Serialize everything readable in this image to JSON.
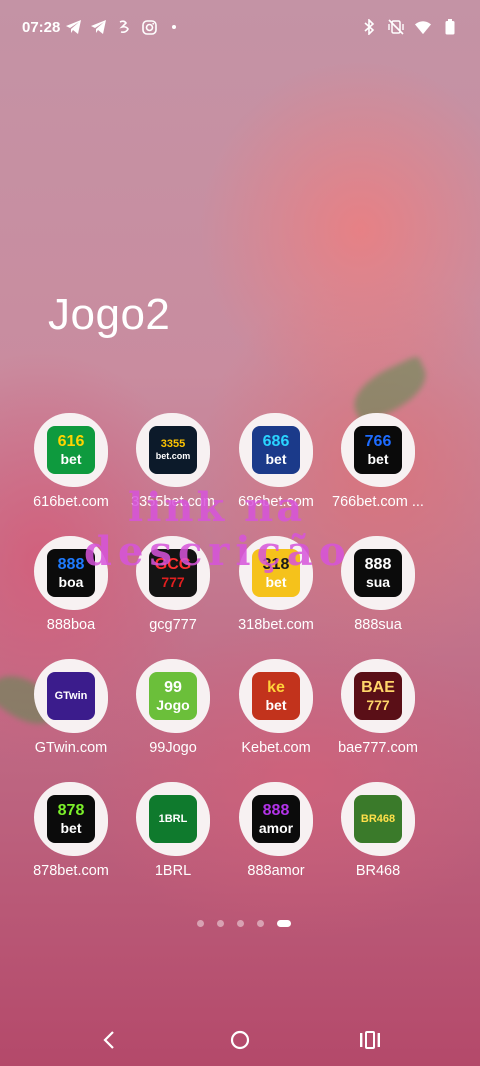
{
  "status_bar": {
    "time": "07:28",
    "left_icons": [
      "telegram-icon",
      "telegram-icon",
      "app-notification-icon",
      "instagram-icon",
      "more-dot-icon"
    ],
    "right_icons": [
      "bluetooth-icon",
      "vibrate-off-icon",
      "wifi-icon",
      "battery-icon"
    ]
  },
  "folder": {
    "title": "Jogo2"
  },
  "apps": [
    {
      "label": "616bet.com",
      "logo_line1": "616",
      "logo_line2": "bet",
      "logo_bg": "#0e9a3e",
      "logo_fg1": "#ffd400",
      "logo_fg2": "#ffffff"
    },
    {
      "label": "3355bet.com",
      "logo_line1": "3355",
      "logo_line2": "bet.com",
      "logo_bg": "#0c1a2a",
      "logo_fg1": "#ffc400",
      "logo_fg2": "#ffffff"
    },
    {
      "label": "686bet.com",
      "logo_line1": "686",
      "logo_line2": "bet",
      "logo_bg": "#1b3a8a",
      "logo_fg1": "#2ad4ff",
      "logo_fg2": "#ffffff"
    },
    {
      "label": "766bet.com ...",
      "logo_line1": "766",
      "logo_line2": "bet",
      "logo_bg": "#0a0a0a",
      "logo_fg1": "#1e6cff",
      "logo_fg2": "#ffffff"
    },
    {
      "label": "888boa",
      "logo_line1": "888",
      "logo_line2": "boa",
      "logo_bg": "#0b0b0b",
      "logo_fg1": "#1e7bff",
      "logo_fg2": "#ffffff"
    },
    {
      "label": "gcg777",
      "logo_line1": "GCG",
      "logo_line2": "777",
      "logo_bg": "#141414",
      "logo_fg1": "#ff3030",
      "logo_fg2": "#e01f1f"
    },
    {
      "label": "318bet.com",
      "logo_line1": "318",
      "logo_line2": "bet",
      "logo_bg": "#f5c21b",
      "logo_fg1": "#1a1a1a",
      "logo_fg2": "#ffffff"
    },
    {
      "label": "888sua",
      "logo_line1": "888",
      "logo_line2": "sua",
      "logo_bg": "#0b0b0b",
      "logo_fg1": "#ffffff",
      "logo_fg2": "#ffffff"
    },
    {
      "label": "GTwin.com",
      "logo_line1": "GTwin",
      "logo_line2": "",
      "logo_bg": "#3b1c8c",
      "logo_fg1": "#ffffff",
      "logo_fg2": "#ffffff"
    },
    {
      "label": "99Jogo",
      "logo_line1": "99",
      "logo_line2": "Jogo",
      "logo_bg": "#6bbf3a",
      "logo_fg1": "#ffffff",
      "logo_fg2": "#ffffff"
    },
    {
      "label": "Kebet.com",
      "logo_line1": "ke",
      "logo_line2": "bet",
      "logo_bg": "#c2331c",
      "logo_fg1": "#ffd23a",
      "logo_fg2": "#ffffff"
    },
    {
      "label": "bae777.com",
      "logo_line1": "BAE",
      "logo_line2": "777",
      "logo_bg": "#5a0f17",
      "logo_fg1": "#ffd56a",
      "logo_fg2": "#ffd56a"
    },
    {
      "label": "878bet.com",
      "logo_line1": "878",
      "logo_line2": "bet",
      "logo_bg": "#0b0b0b",
      "logo_fg1": "#7cf02a",
      "logo_fg2": "#ffffff"
    },
    {
      "label": "1BRL",
      "logo_line1": "1BRL",
      "logo_line2": "",
      "logo_bg": "#0f7a2d",
      "logo_fg1": "#ffffff",
      "logo_fg2": "#ffffff"
    },
    {
      "label": "888amor",
      "logo_line1": "888",
      "logo_line2": "amor",
      "logo_bg": "#0b0b0b",
      "logo_fg1": "#b233e8",
      "logo_fg2": "#ffffff"
    },
    {
      "label": "BR468",
      "logo_line1": "BR468",
      "logo_line2": "",
      "logo_bg": "#3a7a2a",
      "logo_fg1": "#ffe04a",
      "logo_fg2": "#ffffff"
    }
  ],
  "page_indicator": {
    "count": 5,
    "current_page": 5
  },
  "watermark": {
    "line1": "link na",
    "line2": "descrição"
  },
  "nav_bar": {
    "icons": [
      "back-icon",
      "home-icon",
      "recents-icon"
    ]
  },
  "colors": {
    "folder_icon_bg": "#f7f1f2",
    "watermark": "#d654da"
  }
}
